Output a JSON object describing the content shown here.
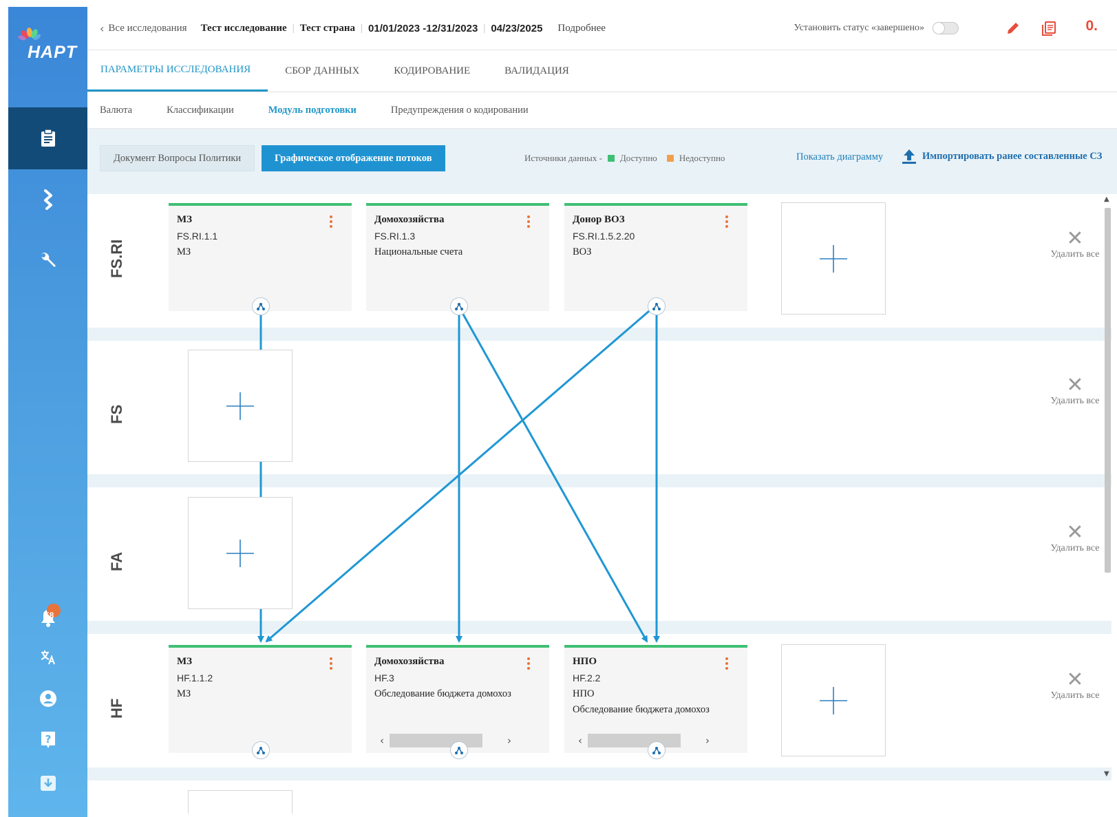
{
  "app": {
    "logo_text": "HAPT"
  },
  "sidebar": {
    "notification_count": "58",
    "items": [
      {
        "icon": "clipboard-icon"
      },
      {
        "icon": "flow-icon"
      },
      {
        "icon": "wrench-icon"
      },
      {
        "icon": "bell-icon"
      },
      {
        "icon": "translate-icon"
      },
      {
        "icon": "user-icon"
      },
      {
        "icon": "help-icon"
      },
      {
        "icon": "download-icon"
      }
    ]
  },
  "header": {
    "back_label": "Все исследования",
    "study_name": "Тест исследование",
    "country": "Тест страна",
    "period": "01/01/2023 -12/31/2023",
    "date": "04/23/2025",
    "more": "Подробнее",
    "status_label": "Установить статус «завершено»",
    "counter": "0."
  },
  "tabs": [
    {
      "label": "ПАРАМЕТРЫ ИССЛЕДОВАНИЯ",
      "active": true
    },
    {
      "label": "СБОР ДАННЫХ"
    },
    {
      "label": "КОДИРОВАНИЕ"
    },
    {
      "label": "ВАЛИДАЦИЯ"
    }
  ],
  "subtabs": [
    {
      "label": "Валюта"
    },
    {
      "label": "Классификации"
    },
    {
      "label": "Модуль подготовки",
      "active": true
    },
    {
      "label": "Предупреждения о кодировании"
    }
  ],
  "toolbar": {
    "segment_inactive": "Документ Вопросы Политики",
    "segment_active": "Графическое отображение потоков",
    "legend_prefix": "Источники данных -",
    "legend_available": "Доступно",
    "legend_unavailable": "Недоступно",
    "available_color": "#3fbf74",
    "unavailable_color": "#f0a04b",
    "show_diagram": "Показать диаграмму",
    "import": "Импортировать ранее составленные СЗ"
  },
  "diagram": {
    "delete_all": "Удалить все",
    "rows": [
      {
        "label": "FS.RI"
      },
      {
        "label": "FS"
      },
      {
        "label": "FA"
      },
      {
        "label": "HF"
      }
    ],
    "fsri_cards": [
      {
        "title": "МЗ",
        "code": "FS.RI.1.1",
        "line3": "МЗ"
      },
      {
        "title": "Домохозяйства",
        "code": "FS.RI.1.3",
        "line3": "Национальные счета"
      },
      {
        "title": "Донор ВОЗ",
        "code": "FS.RI.1.5.2.20",
        "line3": "ВОЗ"
      }
    ],
    "hf_cards": [
      {
        "title": "МЗ",
        "code": "HF.1.1.2",
        "line3": "МЗ",
        "line4": ""
      },
      {
        "title": "Домохозяйства",
        "code": "HF.3",
        "line3": "Обследование бюджета домохоз",
        "line4": ""
      },
      {
        "title": "НПО",
        "code": "HF.2.2",
        "line3": "НПО",
        "line4": "Обследование бюджета домохоз"
      }
    ],
    "arrow_color": "#1f97d4"
  }
}
